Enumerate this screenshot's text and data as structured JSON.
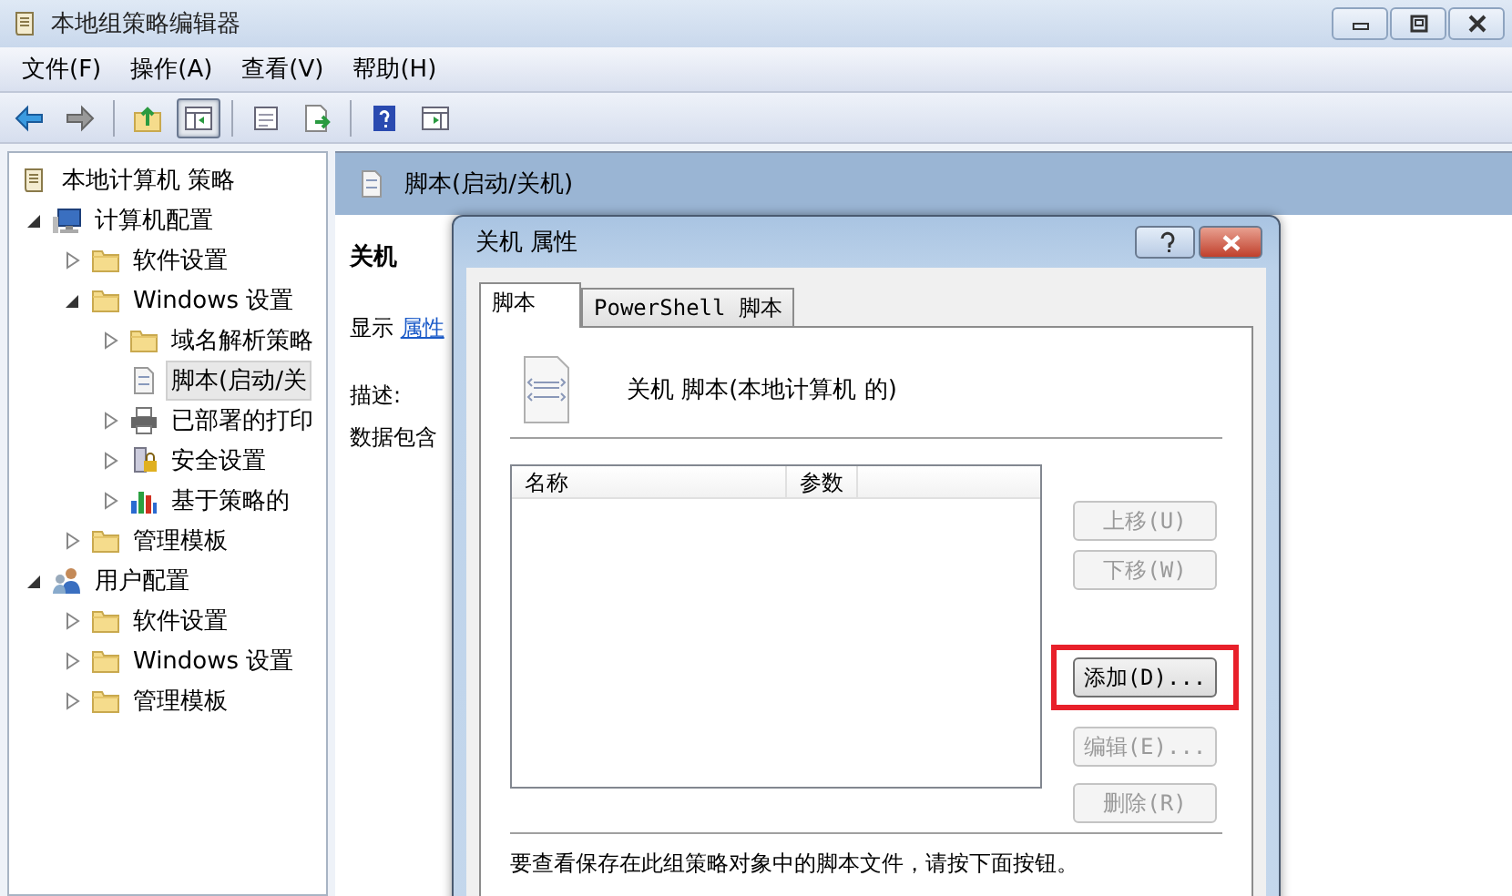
{
  "window": {
    "title": "本地组策略编辑器"
  },
  "menu": [
    "文件(F)",
    "操作(A)",
    "查看(V)",
    "帮助(H)"
  ],
  "toolbar": [
    [
      {
        "kind": "back",
        "pressed": false
      },
      {
        "kind": "forward",
        "pressed": false
      }
    ],
    [
      {
        "kind": "up",
        "pressed": false
      },
      {
        "kind": "tree",
        "pressed": true
      }
    ],
    [
      {
        "kind": "properties",
        "pressed": false
      },
      {
        "kind": "export",
        "pressed": false
      }
    ],
    [
      {
        "kind": "help",
        "pressed": false
      },
      {
        "kind": "pane",
        "pressed": false
      }
    ]
  ],
  "tree": [
    {
      "label": "本地计算机 策略",
      "kind": "policy",
      "selected": false,
      "children": [
        {
          "label": "计算机配置",
          "kind": "computer",
          "selected": false,
          "expanded": true,
          "children": [
            {
              "label": "软件设置",
              "kind": "folder",
              "selected": false,
              "expanded": false
            },
            {
              "label": "Windows 设置",
              "kind": "folder",
              "selected": false,
              "expanded": true,
              "children": [
                {
                  "label": "域名解析策略",
                  "kind": "folder",
                  "selected": false,
                  "expanded": false
                },
                {
                  "label": "脚本(启动/关",
                  "kind": "script",
                  "selected": true
                },
                {
                  "label": "已部署的打印",
                  "kind": "printer",
                  "selected": false,
                  "expanded": false
                },
                {
                  "label": "安全设置",
                  "kind": "security",
                  "selected": false,
                  "expanded": false
                },
                {
                  "label": "基于策略的",
                  "kind": "chart",
                  "selected": false,
                  "expanded": false
                }
              ]
            },
            {
              "label": "管理模板",
              "kind": "folder",
              "selected": false,
              "expanded": false
            }
          ]
        },
        {
          "label": "用户配置",
          "kind": "user",
          "selected": false,
          "expanded": true,
          "children": [
            {
              "label": "软件设置",
              "kind": "folder",
              "selected": false,
              "expanded": false
            },
            {
              "label": "Windows 设置",
              "kind": "folder",
              "selected": false,
              "expanded": false
            },
            {
              "label": "管理模板",
              "kind": "folder",
              "selected": false,
              "expanded": false
            }
          ]
        }
      ]
    }
  ],
  "pane": {
    "title": "脚本(启动/关机)",
    "heading": "关机",
    "show_label": "显示",
    "show_link": "属性",
    "description_label": "描述:",
    "description": "数据包含"
  },
  "dialog": {
    "title": "关机 属性",
    "tabs": [
      {
        "label": "脚本",
        "selected": true
      },
      {
        "label": "PowerShell 脚本",
        "selected": false
      }
    ],
    "header": "关机 脚本(本地计算机 的)",
    "columns": [
      "名称",
      "参数"
    ],
    "button_groups": [
      [
        {
          "label": "上移(U)",
          "disabled": true,
          "highlighted": false
        },
        {
          "label": "下移(W)",
          "disabled": true,
          "highlighted": false
        }
      ],
      [
        {
          "label": "添加(D)...",
          "disabled": false,
          "highlighted": true
        },
        {
          "label": "编辑(E)...",
          "disabled": true,
          "highlighted": false
        },
        {
          "label": "删除(R)",
          "disabled": true,
          "highlighted": false
        }
      ]
    ],
    "footer": "要查看保存在此组策略对象中的脚本文件，请按下面按钮。"
  }
}
